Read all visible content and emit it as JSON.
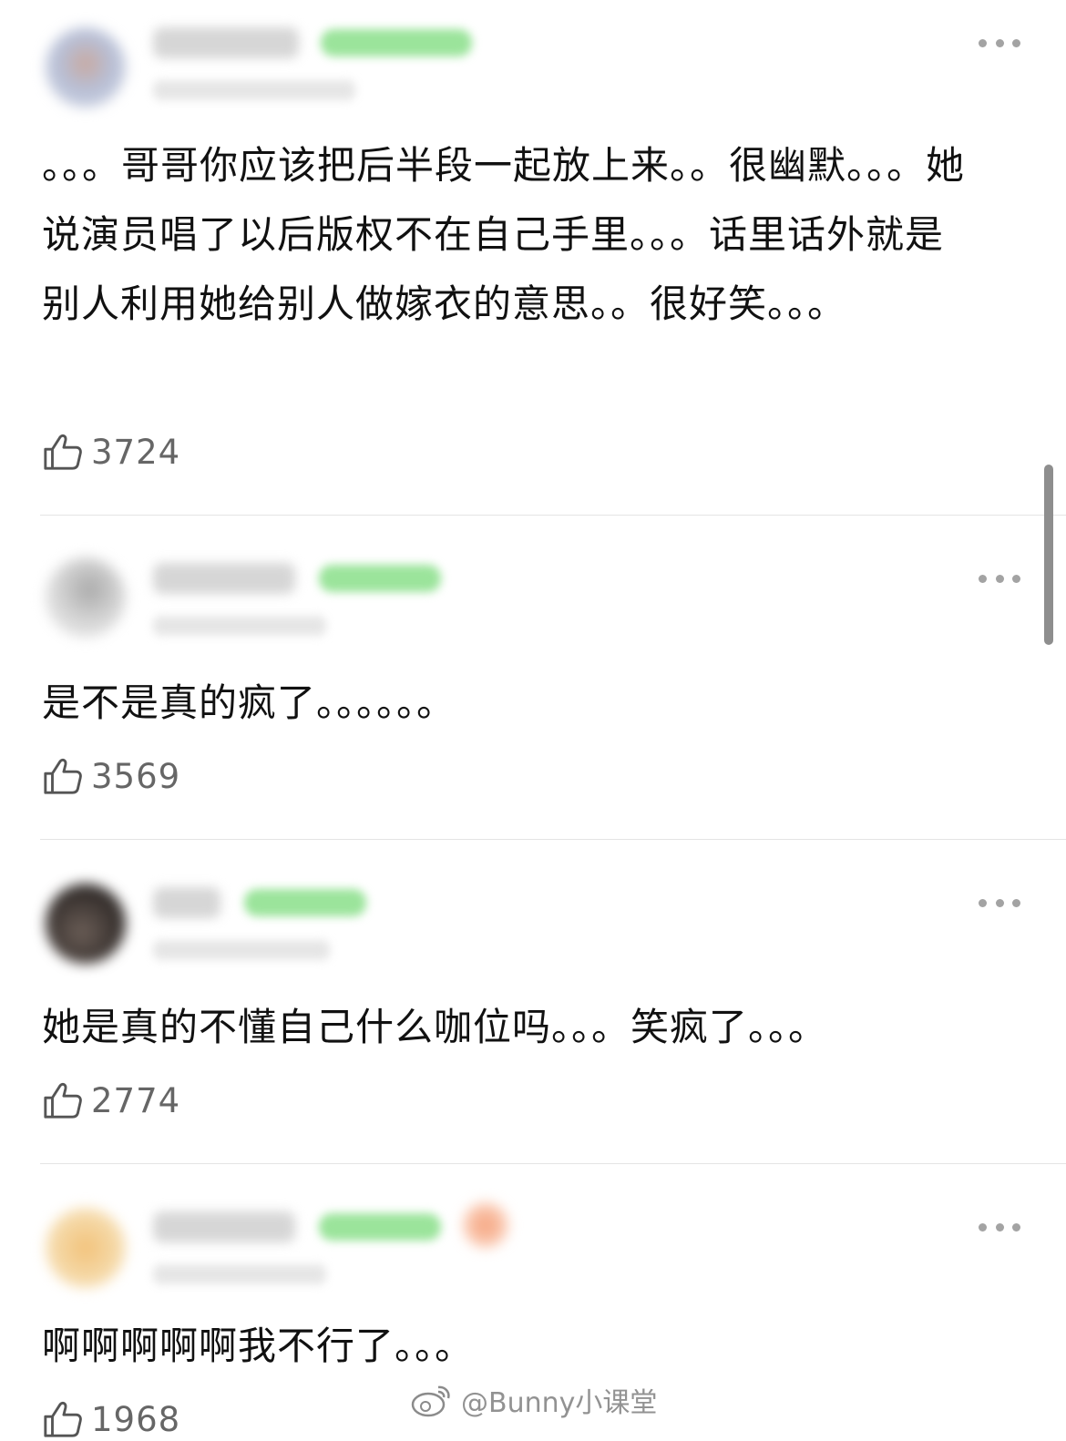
{
  "comments": [
    {
      "text": "。。。哥哥你应该把后半段一起放上来。。很幽默。。。她说演员唱了以后版权不在自己手里。。。话里话外就是别人利用她给别人做嫁衣的意思。。很好笑。。。",
      "likes": "3724"
    },
    {
      "text": "是不是真的疯了。。。。。。",
      "likes": "3569"
    },
    {
      "text": "她是真的不懂自己什么咖位吗。。。笑疯了。。。",
      "likes": "2774"
    },
    {
      "text": "啊啊啊啊啊我不行了。。。",
      "likes": "1968"
    }
  ],
  "watermark": {
    "text": "@Bunny小课堂",
    "icon": "weibo-icon"
  },
  "icons": {
    "like": "thumbs-up-icon",
    "more": "more-horizontal-icon"
  },
  "colors": {
    "badge": "#9be49b",
    "text": "#111111",
    "muted": "#666666",
    "divider": "#e4e4e4"
  }
}
